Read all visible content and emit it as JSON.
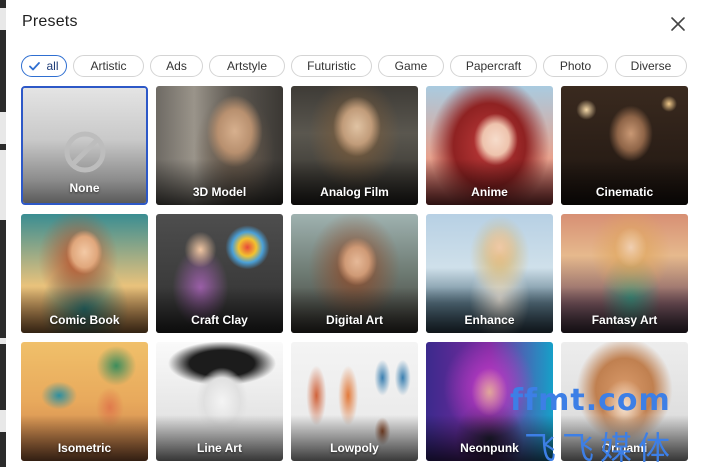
{
  "dialog": {
    "title": "Presets",
    "close_icon": "close-icon"
  },
  "filters": [
    {
      "label": "all",
      "active": true
    },
    {
      "label": "Artistic",
      "active": false
    },
    {
      "label": "Ads",
      "active": false
    },
    {
      "label": "Artstyle",
      "active": false
    },
    {
      "label": "Futuristic",
      "active": false
    },
    {
      "label": "Game",
      "active": false
    },
    {
      "label": "Papercraft",
      "active": false
    },
    {
      "label": "Photo",
      "active": false
    },
    {
      "label": "Diverse",
      "active": false
    }
  ],
  "presets": [
    {
      "label": "None",
      "selected": true,
      "icon": "prohibited-icon"
    },
    {
      "label": "3D Model",
      "selected": false
    },
    {
      "label": "Analog Film",
      "selected": false
    },
    {
      "label": "Anime",
      "selected": false
    },
    {
      "label": "Cinematic",
      "selected": false
    },
    {
      "label": "Comic Book",
      "selected": false
    },
    {
      "label": "Craft Clay",
      "selected": false
    },
    {
      "label": "Digital Art",
      "selected": false
    },
    {
      "label": "Enhance",
      "selected": false
    },
    {
      "label": "Fantasy Art",
      "selected": false
    },
    {
      "label": "Isometric",
      "selected": false
    },
    {
      "label": "Line Art",
      "selected": false
    },
    {
      "label": "Lowpoly",
      "selected": false
    },
    {
      "label": "Neonpunk",
      "selected": false
    },
    {
      "label": "Origami",
      "selected": false
    }
  ],
  "watermark": {
    "line1": "ffmt.com",
    "line2": "飞飞媒体"
  },
  "colors": {
    "accent": "#2f6fd1",
    "selected_border": "#2d58c7",
    "watermark": "#3d7fe6"
  }
}
